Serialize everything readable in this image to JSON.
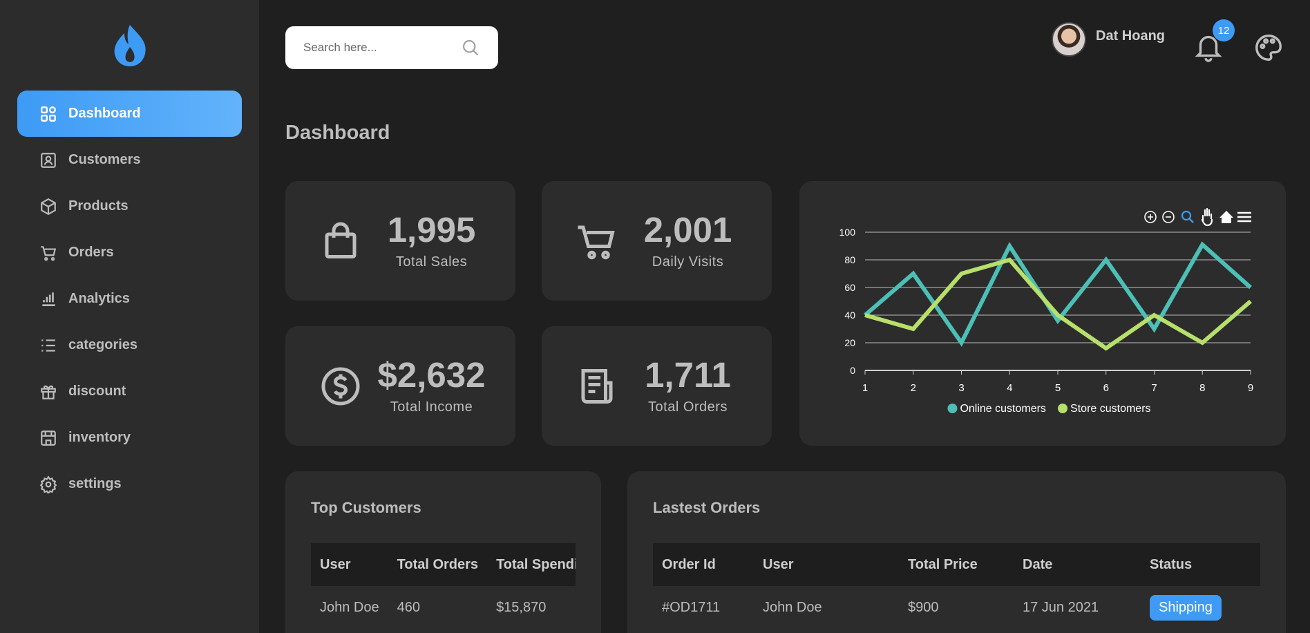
{
  "sidebar": {
    "logo_icon": "flame-icon",
    "items": [
      {
        "label": "Dashboard",
        "icon": "grid-icon",
        "active": true
      },
      {
        "label": "Customers",
        "icon": "id-card-icon"
      },
      {
        "label": "Products",
        "icon": "box-icon"
      },
      {
        "label": "Orders",
        "icon": "cart-icon"
      },
      {
        "label": "Analytics",
        "icon": "bar-chart-icon"
      },
      {
        "label": "categories",
        "icon": "list-icon"
      },
      {
        "label": "discount",
        "icon": "gift-icon"
      },
      {
        "label": "inventory",
        "icon": "store-icon"
      },
      {
        "label": "settings",
        "icon": "gear-icon"
      }
    ]
  },
  "header": {
    "search_placeholder": "Search here...",
    "user_name": "Dat Hoang",
    "notification_count": "12"
  },
  "page_title": "Dashboard",
  "stats": [
    {
      "value": "1,995",
      "label": "Total Sales",
      "icon": "shopping-bag-icon"
    },
    {
      "value": "2,001",
      "label": "Daily Visits",
      "icon": "cart-icon"
    },
    {
      "value": "$2,632",
      "label": "Total Income",
      "icon": "dollar-circle-icon"
    },
    {
      "value": "1,711",
      "label": "Total Orders",
      "icon": "receipt-icon"
    }
  ],
  "chart_data": {
    "type": "line",
    "x": [
      1,
      2,
      3,
      4,
      5,
      6,
      7,
      8,
      9
    ],
    "ylim": [
      0,
      100
    ],
    "yticks": [
      0,
      20,
      40,
      60,
      80,
      100
    ],
    "grid": true,
    "legend_position": "bottom",
    "series": [
      {
        "name": "Online customers",
        "color": "#4cbfb6",
        "values": [
          40,
          70,
          20,
          90,
          36,
          80,
          30,
          91,
          60
        ]
      },
      {
        "name": "Store customers",
        "color": "#b7e06a",
        "values": [
          40,
          30,
          70,
          80,
          40,
          16,
          40,
          20,
          50
        ]
      }
    ],
    "toolbar": [
      "zoom-in-icon",
      "zoom-out-icon",
      "magnifier-icon",
      "pan-hand-icon",
      "home-icon",
      "menu-icon"
    ]
  },
  "top_customers": {
    "title": "Top Customers",
    "columns": [
      "User",
      "Total Orders",
      "Total Spending"
    ],
    "rows": [
      [
        "John Doe",
        "460",
        "$15,870"
      ]
    ]
  },
  "latest_orders": {
    "title": "Lastest Orders",
    "columns": [
      "Order Id",
      "User",
      "Total Price",
      "Date",
      "Status"
    ],
    "rows": [
      [
        "#OD1711",
        "John Doe",
        "$900",
        "17 Jun 2021",
        "Shipping"
      ]
    ],
    "status_color": "#3d9bf5"
  }
}
